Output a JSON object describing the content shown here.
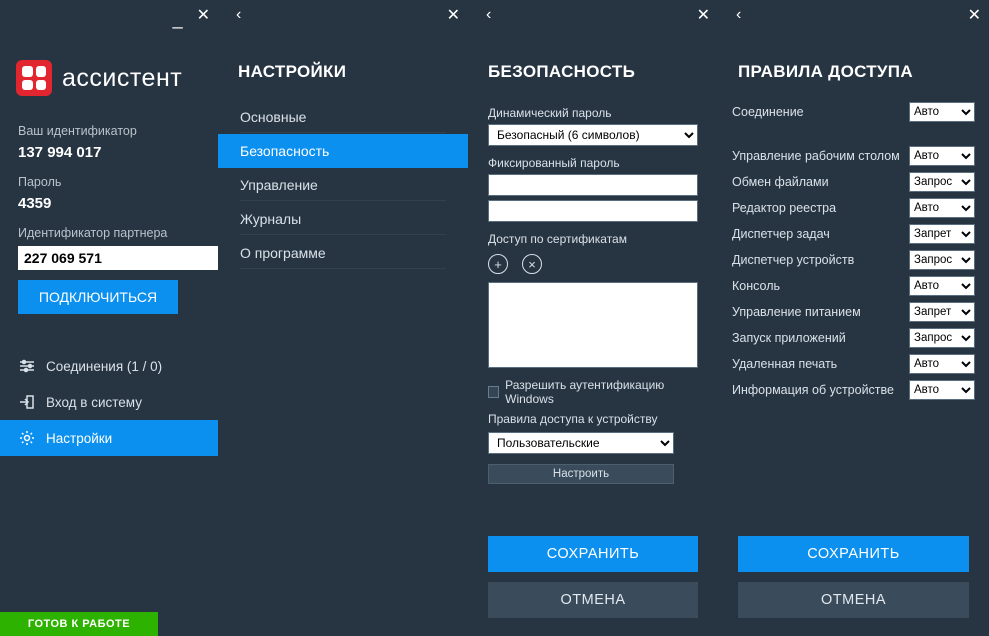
{
  "app": {
    "name": "ассистент"
  },
  "identity": {
    "id_label": "Ваш идентификатор",
    "id_value": "137 994 017",
    "password_label": "Пароль",
    "password_value": "4359",
    "partner_label": "Идентификатор партнера",
    "partner_value": "227 069 571",
    "connect_label": "ПОДКЛЮЧИТЬСЯ"
  },
  "menu": {
    "connections": "Соединения (1 / 0)",
    "login": "Вход в систему",
    "settings": "Настройки"
  },
  "status": "ГОТОВ К РАБОТЕ",
  "settings_panel": {
    "title": "НАСТРОЙКИ",
    "items": [
      "Основные",
      "Безопасность",
      "Управление",
      "Журналы",
      "О программе"
    ],
    "active_index": 1
  },
  "security_panel": {
    "title": "БЕЗОПАСНОСТЬ",
    "dyn_pw_label": "Динамический пароль",
    "dyn_pw_value": "Безопасный (6 символов)",
    "fixed_pw_label": "Фиксированный пароль",
    "fixed_pw_value1": "",
    "fixed_pw_value2": "",
    "cert_label": "Доступ по сертификатам",
    "win_auth_label": "Разрешить аутентификацию Windows",
    "rules_label": "Правила доступа к устройству",
    "rules_value": "Пользовательские",
    "configure_btn": "Настроить",
    "save": "СОХРАНИТЬ",
    "cancel": "ОТМЕНА"
  },
  "rules_panel": {
    "title": "ПРАВИЛА ДОСТУПА",
    "options": [
      "Авто",
      "Запрос",
      "Запрет"
    ],
    "rows": [
      {
        "label": "Соединение",
        "value": "Авто"
      },
      {
        "label": "Управление рабочим столом",
        "value": "Авто"
      },
      {
        "label": "Обмен файлами",
        "value": "Запрос"
      },
      {
        "label": "Редактор реестра",
        "value": "Авто"
      },
      {
        "label": "Диспетчер задач",
        "value": "Запрет"
      },
      {
        "label": "Диспетчер устройств",
        "value": "Запрос"
      },
      {
        "label": "Консоль",
        "value": "Авто"
      },
      {
        "label": "Управление питанием",
        "value": "Запрет"
      },
      {
        "label": "Запуск приложений",
        "value": "Запрос"
      },
      {
        "label": "Удаленная печать",
        "value": "Авто"
      },
      {
        "label": "Информация об устройстве",
        "value": "Авто"
      }
    ],
    "save": "СОХРАНИТЬ",
    "cancel": "ОТМЕНА"
  }
}
